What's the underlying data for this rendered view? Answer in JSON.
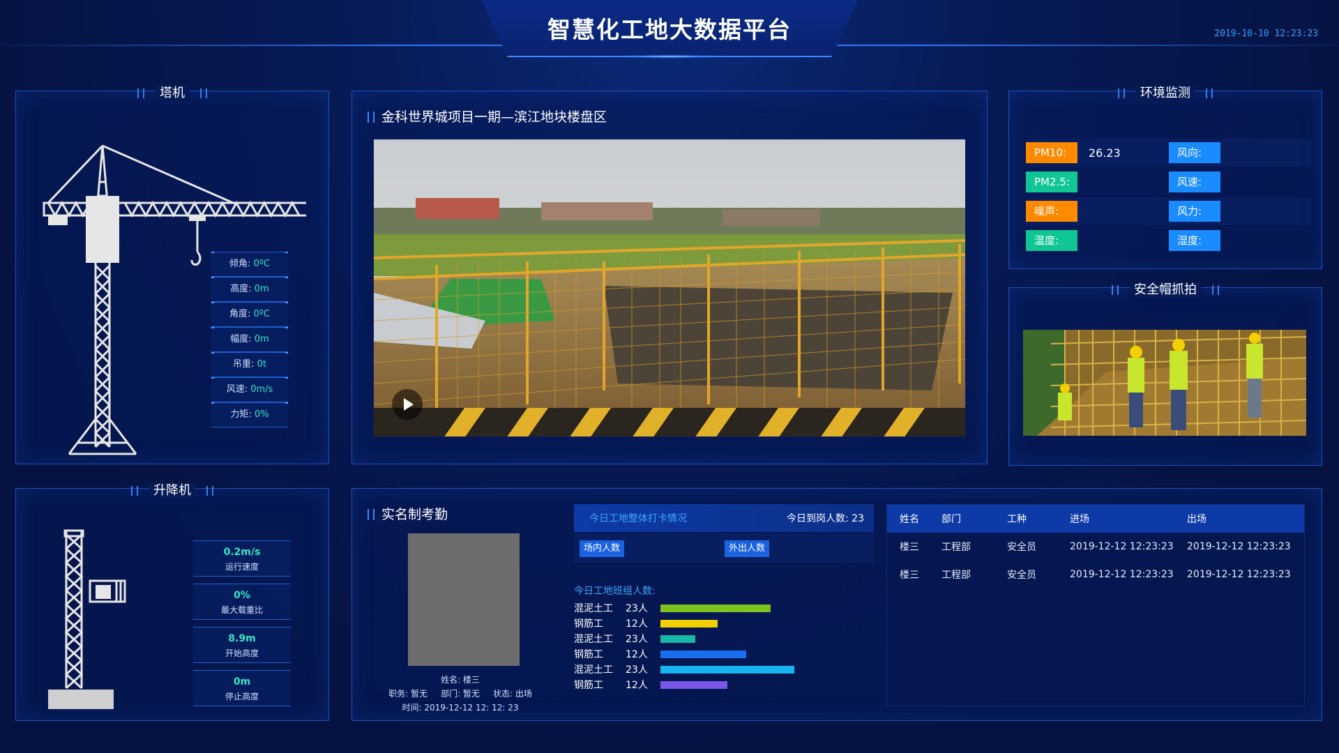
{
  "header": {
    "title": "智慧化工地大数据平台",
    "datetime": "2019-10-10 12:23:23"
  },
  "tower_crane": {
    "title": "塔机",
    "stats": [
      {
        "label": "倾角:",
        "value": "0ºC"
      },
      {
        "label": "高度:",
        "value": "0m"
      },
      {
        "label": "角度:",
        "value": "0ºC"
      },
      {
        "label": "幅度:",
        "value": "0m"
      },
      {
        "label": "吊重:",
        "value": "0t"
      },
      {
        "label": "风速:",
        "value": "0m/s"
      },
      {
        "label": "力矩:",
        "value": "0%"
      }
    ]
  },
  "elevator": {
    "title": "升降机",
    "stats": [
      {
        "value": "0.2m/s",
        "label": "运行速度"
      },
      {
        "value": "0%",
        "label": "最大载重比"
      },
      {
        "value": "8.9m",
        "label": "开始高度"
      },
      {
        "value": "0m",
        "label": "停止高度"
      }
    ]
  },
  "video": {
    "title": "金科世界城项目一期—滨江地块楼盘区"
  },
  "environment": {
    "title": "环境监测",
    "rows": [
      {
        "left_label": "PM10:",
        "left_value": "26.23",
        "right_label": "风向:",
        "right_value": ""
      },
      {
        "left_label": "PM2.5:",
        "left_value": "",
        "right_label": "风速:",
        "right_value": ""
      },
      {
        "left_label": "噪声:",
        "left_value": "",
        "right_label": "风力:",
        "right_value": ""
      },
      {
        "left_label": "温度:",
        "left_value": "",
        "right_label": "湿度:",
        "right_value": ""
      }
    ],
    "colors": {
      "orange": "#ff8a00",
      "teal": "#0fc694",
      "blue": "#1a8cff"
    }
  },
  "helmet": {
    "title": "安全帽抓拍"
  },
  "attendance": {
    "title": "实名制考勤",
    "person": {
      "name": "姓名: 楼三",
      "line2": "职务: 暂无     部门: 暂无     状态: 出场",
      "time": "时间: 2019-12-12 12: 12: 23"
    },
    "checkin": {
      "title": "今日工地整体打卡情况",
      "count": "今日到岗人数: 23",
      "in_label": "场内人数",
      "out_label": "外出人数"
    },
    "teams_title": "今日工地班组人数:",
    "teams": [
      {
        "name": "混泥土工",
        "count": "23人",
        "value": 23,
        "color": "#7dc21e"
      },
      {
        "name": "钢筋工",
        "count": "12人",
        "value": 12,
        "color": "#f2d000"
      },
      {
        "name": "混泥土工",
        "count": "23人",
        "value": 7.3,
        "color": "#16b8a6"
      },
      {
        "name": "钢筋工",
        "count": "12人",
        "value": 18,
        "color": "#1a6ff0"
      },
      {
        "name": "混泥土工",
        "count": "23人",
        "value": 28,
        "color": "#18b4f0"
      },
      {
        "name": "钢筋工",
        "count": "12人",
        "value": 14,
        "color": "#7b55e8"
      }
    ],
    "table": {
      "headers": [
        "姓名",
        "部门",
        "工种",
        "进场",
        "出场"
      ],
      "rows": [
        [
          "楼三",
          "工程部",
          "安全员",
          "2019-12-12 12:23:23",
          "2019-12-12 12:23:23"
        ],
        [
          "楼三",
          "工程部",
          "安全员",
          "2019-12-12 12:23:23",
          "2019-12-12 12:23:23"
        ]
      ]
    }
  }
}
